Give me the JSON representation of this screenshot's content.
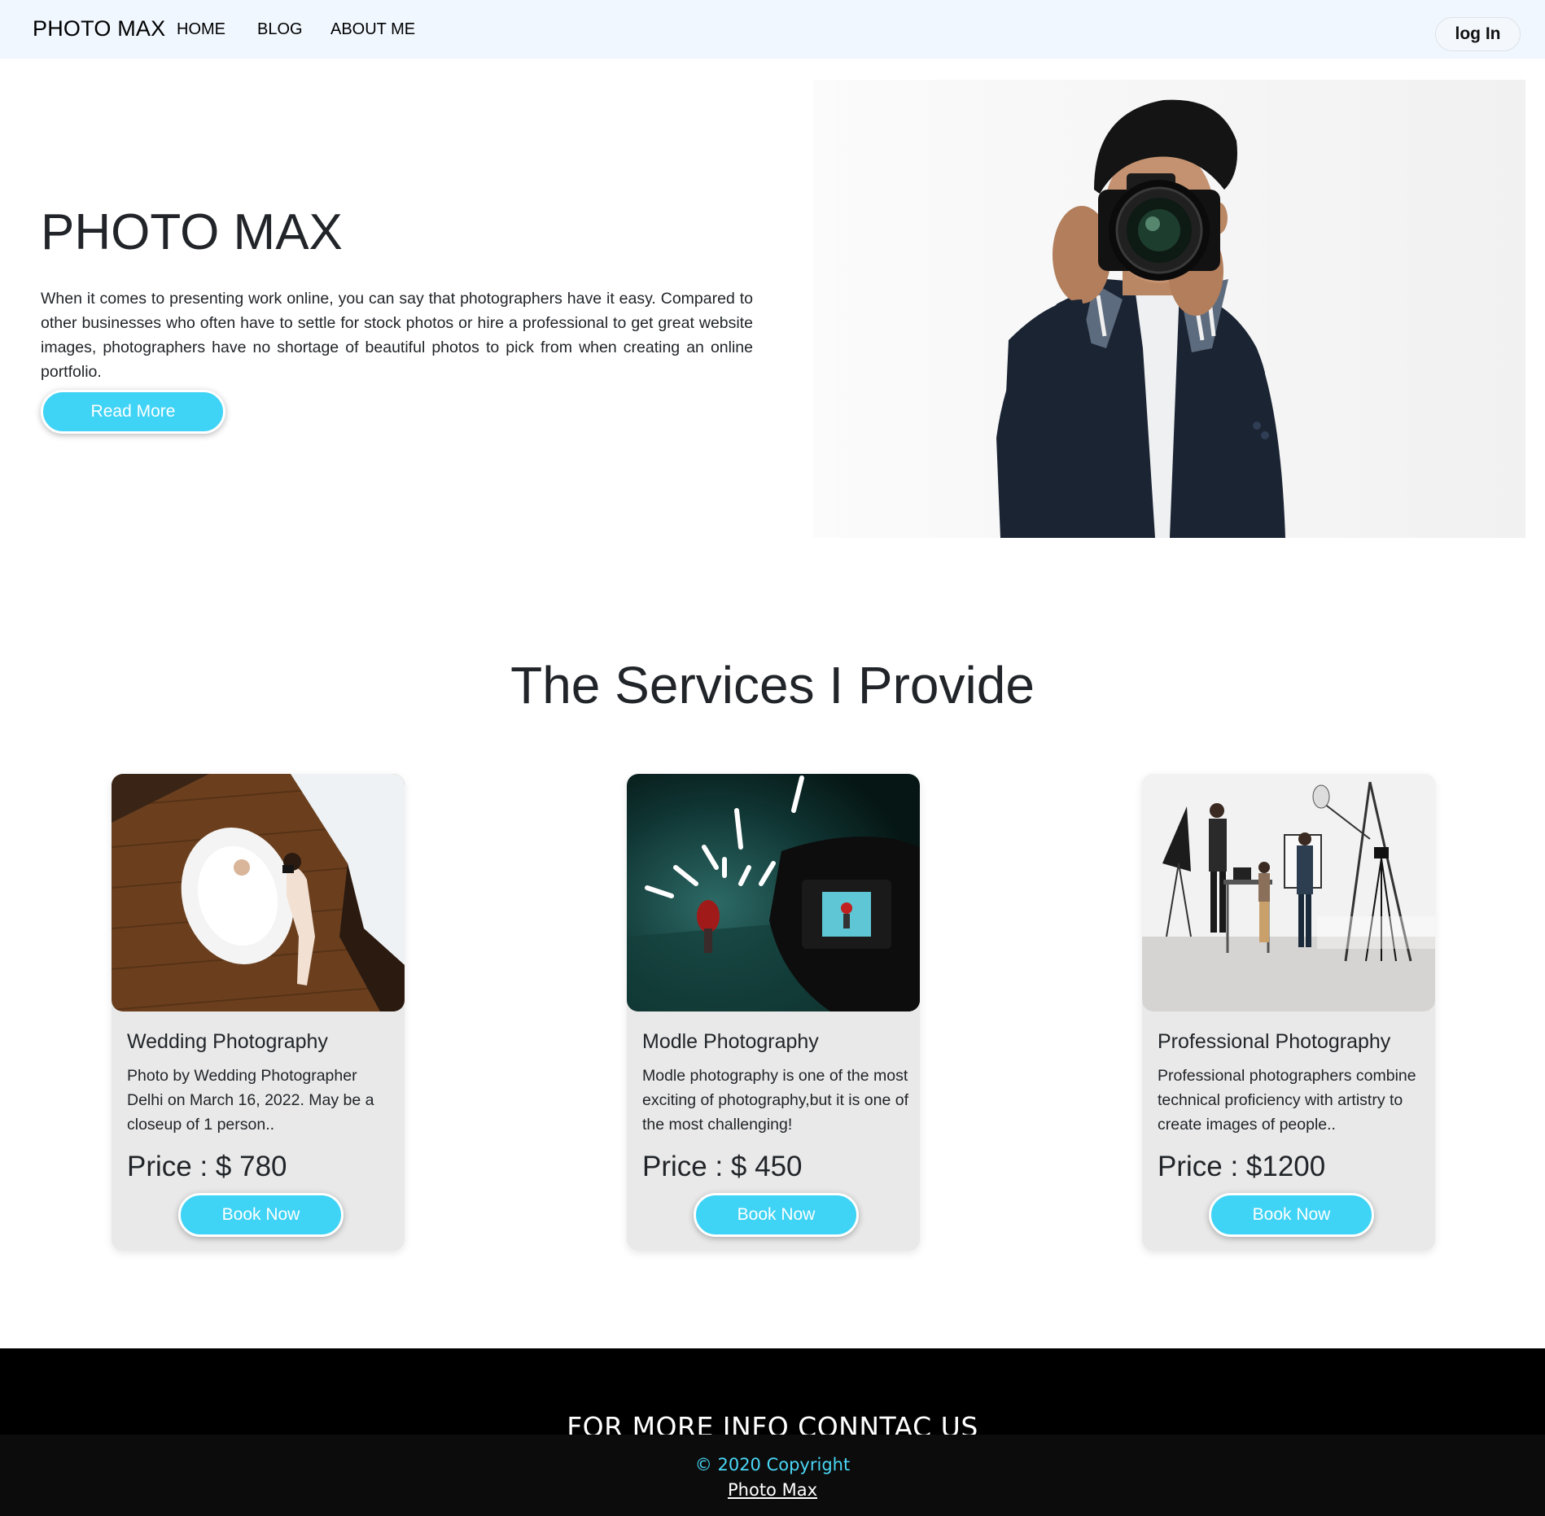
{
  "navbar": {
    "brand": "PHOTO MAX",
    "links": [
      "HOME",
      "BLOG",
      "ABOUT ME"
    ],
    "login_label": "log In"
  },
  "hero": {
    "title": "PHOTO MAX",
    "text": "When it comes to presenting work online, you can say that photographers have it easy. Compared to other businesses who often have to settle for stock photos or hire a professional to get great website images, photographers have no shortage of beautiful photos to pick from when creating an online portfolio.",
    "button_label": "Read More"
  },
  "services": {
    "title": "The Services I Provide",
    "cards": [
      {
        "title": "Wedding Photography",
        "text": "Photo by Wedding Photographer Delhi on March 16, 2022. May be a closeup of 1 person..",
        "price": "Price : $ 780",
        "button_label": "Book Now"
      },
      {
        "title": "Modle Photography",
        "text": "Modle photography is one of the most exciting of photography,but it is one of the most challenging!",
        "price": "Price : $ 450",
        "button_label": "Book Now"
      },
      {
        "title": "Professional Photography",
        "text": "Professional photographers combine technical proficiency with artistry to create images of people..",
        "price": "Price : $1200",
        "button_label": "Book Now"
      }
    ]
  },
  "footer": {
    "title": "FOR MORE INFO CONNTAC US",
    "copyright": "© 2020 Copyright",
    "link": "Photo Max"
  },
  "colors": {
    "accent": "#3fd3f5",
    "navbar_bg": "#f0f7ff",
    "card_bg": "#e9e9e9",
    "footer_bg": "#000000"
  }
}
